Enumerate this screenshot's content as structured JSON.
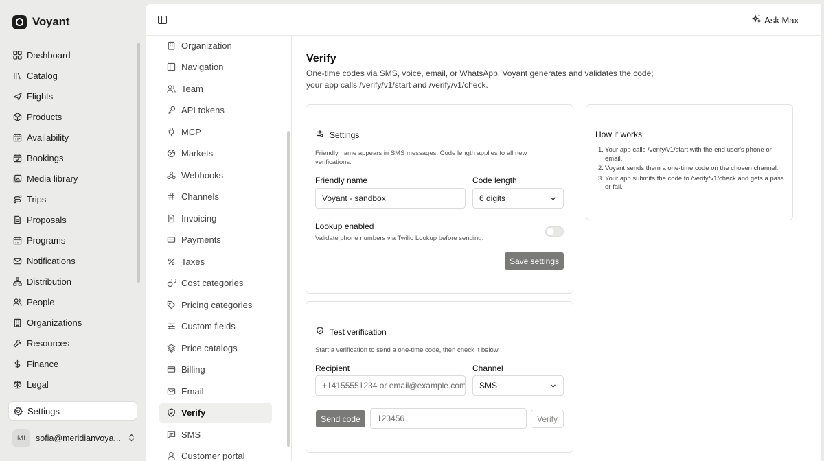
{
  "brand": {
    "name": "Voyant"
  },
  "nav": [
    {
      "label": "Dashboard",
      "icon": "dashboard-icon"
    },
    {
      "label": "Catalog",
      "icon": "catalog-icon"
    },
    {
      "label": "Flights",
      "icon": "plane-icon"
    },
    {
      "label": "Products",
      "icon": "box-icon"
    },
    {
      "label": "Availability",
      "icon": "calendar-icon"
    },
    {
      "label": "Bookings",
      "icon": "calendar-check-icon"
    },
    {
      "label": "Media library",
      "icon": "image-icon"
    },
    {
      "label": "Trips",
      "icon": "route-icon"
    },
    {
      "label": "Proposals",
      "icon": "document-icon"
    },
    {
      "label": "Programs",
      "icon": "calendar-icon"
    },
    {
      "label": "Notifications",
      "icon": "mail-icon"
    },
    {
      "label": "Distribution",
      "icon": "network-icon"
    },
    {
      "label": "People",
      "icon": "users-icon"
    },
    {
      "label": "Organizations",
      "icon": "building-icon"
    },
    {
      "label": "Resources",
      "icon": "wrench-icon"
    },
    {
      "label": "Finance",
      "icon": "dollar-icon"
    },
    {
      "label": "Legal",
      "icon": "scale-icon"
    }
  ],
  "settings_label": "Settings",
  "user": {
    "initials": "MI",
    "email": "sofia@meridianvoya..."
  },
  "topbar": {
    "ask_label": "Ask Max"
  },
  "subnav": [
    {
      "label": "Organization",
      "icon": "building-icon"
    },
    {
      "label": "Navigation",
      "icon": "sidebar-icon"
    },
    {
      "label": "Team",
      "icon": "users-icon"
    },
    {
      "label": "API tokens",
      "icon": "key-icon"
    },
    {
      "label": "MCP",
      "icon": "plug-icon"
    },
    {
      "label": "Markets",
      "icon": "globe-icon"
    },
    {
      "label": "Webhooks",
      "icon": "webhook-icon"
    },
    {
      "label": "Channels",
      "icon": "hash-icon"
    },
    {
      "label": "Invoicing",
      "icon": "document-icon"
    },
    {
      "label": "Payments",
      "icon": "credit-card-icon"
    },
    {
      "label": "Taxes",
      "icon": "percent-icon"
    },
    {
      "label": "Cost categories",
      "icon": "coins-icon"
    },
    {
      "label": "Pricing categories",
      "icon": "tag-icon"
    },
    {
      "label": "Custom fields",
      "icon": "sliders-icon"
    },
    {
      "label": "Price catalogs",
      "icon": "layers-icon"
    },
    {
      "label": "Billing",
      "icon": "credit-card-icon"
    },
    {
      "label": "Email",
      "icon": "mail-icon"
    },
    {
      "label": "Verify",
      "icon": "shield-check-icon",
      "active": true
    },
    {
      "label": "SMS",
      "icon": "message-icon"
    },
    {
      "label": "Customer portal",
      "icon": "user-icon"
    }
  ],
  "page": {
    "title": "Verify",
    "description": "One-time codes via SMS, voice, email, or WhatsApp. Voyant generates and validates the code; your app calls /verify/v1/start and /verify/v1/check."
  },
  "settings_card": {
    "title": "Settings",
    "description": "Friendly name appears in SMS messages. Code length applies to all new verifications.",
    "friendly_name_label": "Friendly name",
    "friendly_name_value": "Voyant - sandbox",
    "code_length_label": "Code length",
    "code_length_value": "6 digits",
    "lookup_label": "Lookup enabled",
    "lookup_desc": "Validate phone numbers via Twilio Lookup before sending.",
    "lookup_enabled": false,
    "save_label": "Save settings"
  },
  "how_card": {
    "title": "How it works",
    "steps": [
      "Your app calls /verify/v1/start with the end user's phone or email.",
      "Voyant sends them a one-time code on the chosen channel.",
      "Your app submits the code to /verify/v1/check and gets a pass or fail."
    ]
  },
  "test_card": {
    "title": "Test verification",
    "description": "Start a verification to send a one-time code, then check it below.",
    "recipient_label": "Recipient",
    "recipient_placeholder": "+14155551234 or email@example.com",
    "channel_label": "Channel",
    "channel_value": "SMS",
    "send_label": "Send code",
    "code_placeholder": "123456",
    "verify_label": "Verify"
  }
}
